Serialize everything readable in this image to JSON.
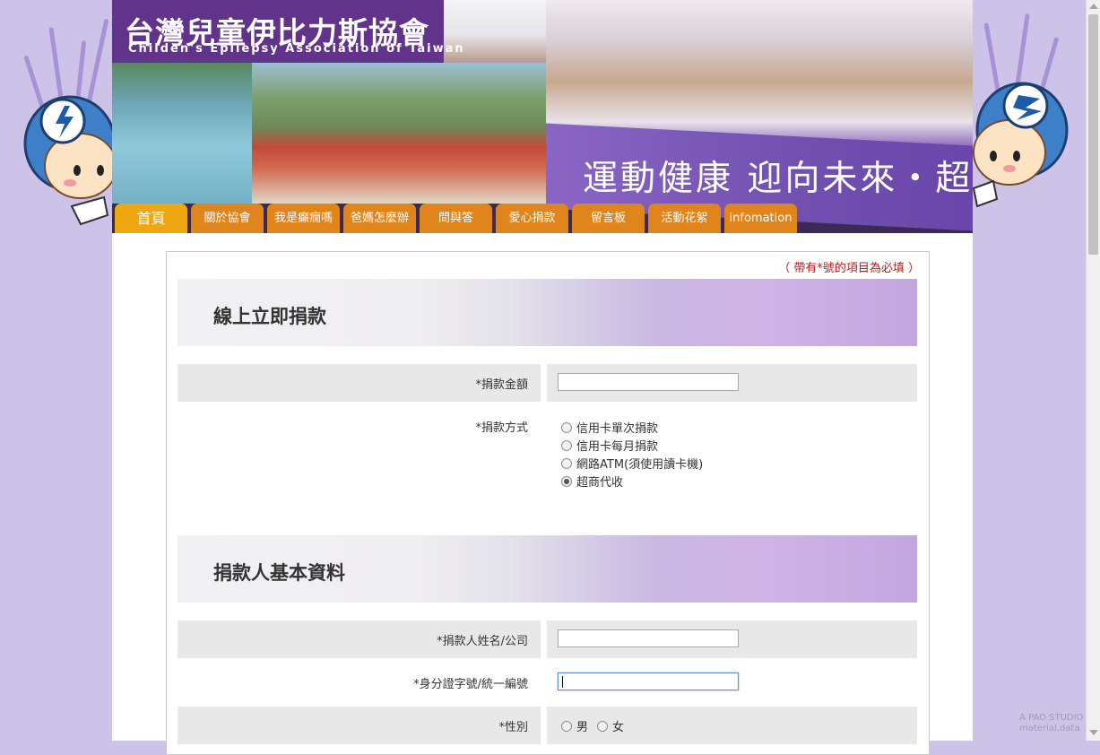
{
  "header": {
    "logo_title": "台灣兒童伊比力斯協會",
    "logo_subtitle": "Childen's Epilepsy Association of Taiwan",
    "slogan": "運動健康 迎向未來・超"
  },
  "nav": {
    "items": [
      "首頁",
      "關於協會",
      "我是癲癇嗎",
      "爸媽怎麼辦",
      "問與答",
      "愛心捐款",
      "留言板",
      "活動花絮",
      "infomation"
    ],
    "active_index": 0
  },
  "form": {
    "required_note": "（ 帶有*號的項目為必填 ）",
    "section1_title": "線上立即捐款",
    "amount_label": "*捐款金額",
    "amount_value": "",
    "method_label": "*捐款方式",
    "methods": [
      {
        "label": "信用卡單次捐款",
        "checked": false
      },
      {
        "label": "信用卡每月捐款",
        "checked": false
      },
      {
        "label": "網路ATM(須使用讀卡機)",
        "checked": false
      },
      {
        "label": "超商代收",
        "checked": true
      }
    ],
    "section2_title": "捐款人基本資料",
    "name_label": "*捐款人姓名/公司",
    "name_value": "",
    "id_label": "*身分證字號/統一編號",
    "id_value": "",
    "gender_label": "*性別",
    "gender_options": [
      {
        "label": "男",
        "checked": false
      },
      {
        "label": "女",
        "checked": false
      }
    ]
  },
  "watermark": "A PAO STUDIO material.data",
  "colors": {
    "page_bg": "#cdc3e8",
    "nav_tab": "#e0841c",
    "nav_active": "#f0a812",
    "logo_bg": "#62338a",
    "required_red": "#b22222",
    "row_shade": "#e8e8e8"
  }
}
